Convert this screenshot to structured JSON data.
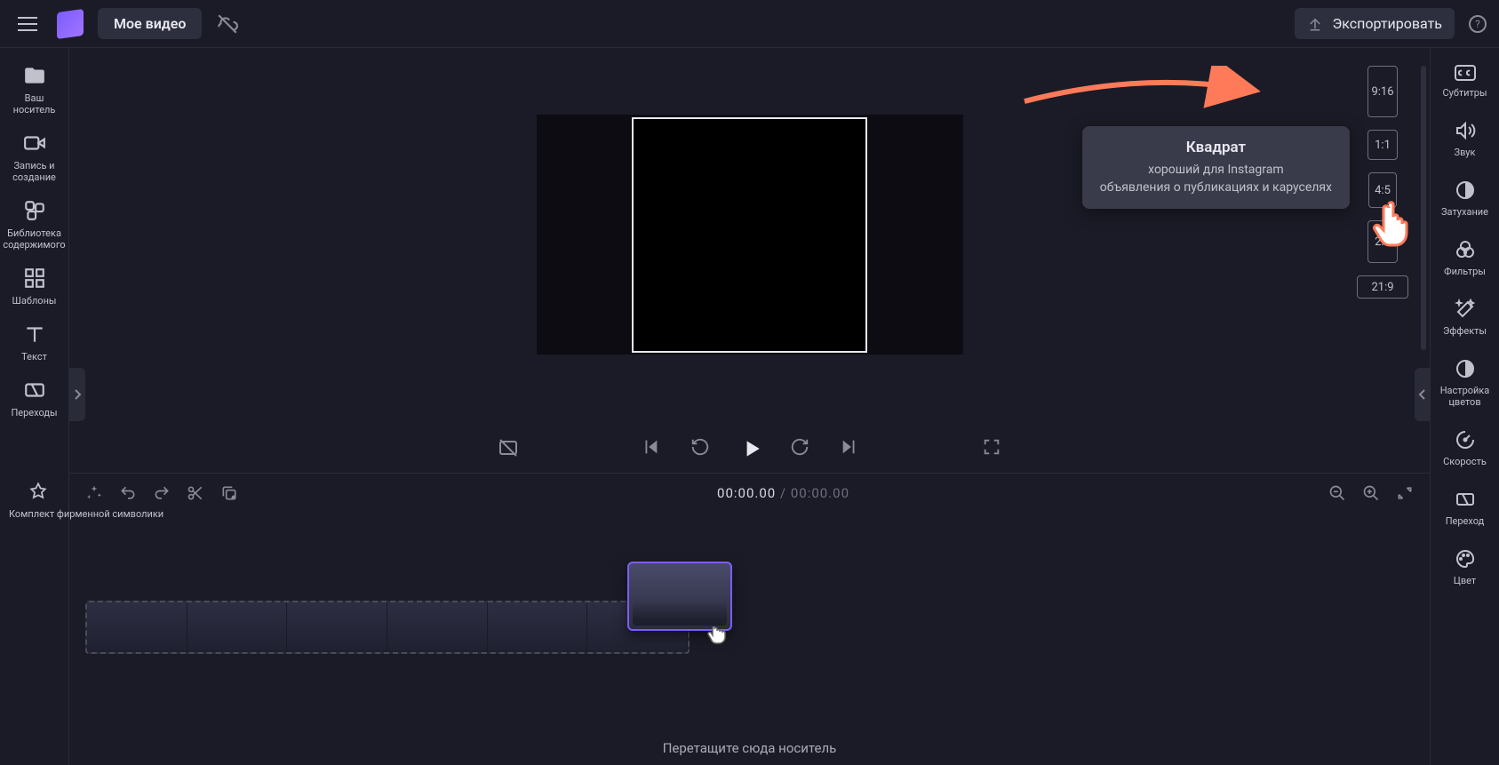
{
  "header": {
    "title": "Мое видео",
    "export": "Экспортировать"
  },
  "leftSidebar": {
    "media": "Ваш носитель",
    "record": "Запись и создание",
    "library": "Библиотека содержимого",
    "templates": "Шаблоны",
    "text": "Текст",
    "transitions": "Переходы",
    "brandkit": "Комплект фирменной символики"
  },
  "aspect": {
    "r916": "9:16",
    "r11": "1:1",
    "r45": "4:5",
    "r23": "2:3",
    "r219": "21:9"
  },
  "tooltip": {
    "title": "Квадрат",
    "line1": "хороший для Instagram",
    "line2": "объявления о публикациях и каруселях"
  },
  "time": {
    "current": "00:00.00",
    "sep": " / ",
    "total": "00:00.00"
  },
  "timeline": {
    "dropHint": "Перетащите сюда носитель"
  },
  "rightSidebar": {
    "subtitles": "Субтитры",
    "audio": "Звук",
    "fade": "Затухание",
    "filters": "Фильтры",
    "effects": "Эффекты",
    "colorAdjust": "Настройка цветов",
    "speed": "Скорость",
    "transition": "Переход",
    "color": "Цвет"
  }
}
